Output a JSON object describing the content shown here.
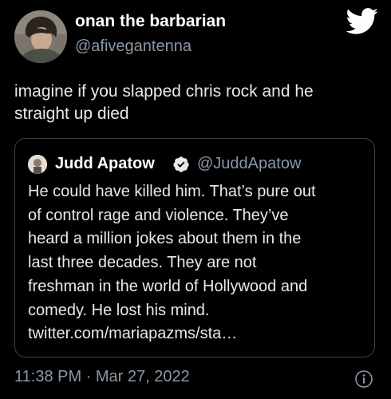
{
  "author": {
    "display_name": "onan the barbarian",
    "handle": "@afivegantenna"
  },
  "tweet": {
    "text": "imagine if you slapped chris rock and he\nstraight up died",
    "timestamp": "11:38 PM · Mar 27, 2022"
  },
  "quoted_tweet": {
    "display_name": "Judd Apatow",
    "handle": "@JuddApatow",
    "verified": true,
    "text": "He could have killed him.  That’s pure out\nof control rage and violence.    They’ve\nheard a million jokes about them in the\nlast three decades.  They are not\nfreshman in the world of Hollywood and\ncomedy.  He lost his mind.\ntwitter.com/mariapazms/sta…"
  },
  "icons": {
    "brand": "twitter-bird-icon",
    "verified": "verified-badge-icon",
    "info": "info-icon"
  },
  "colors": {
    "background": "#000000",
    "text": "#e7e9ea",
    "secondary_text": "#8b98a5",
    "border": "#3e4144",
    "verified_badge": "#e7e9ea"
  }
}
